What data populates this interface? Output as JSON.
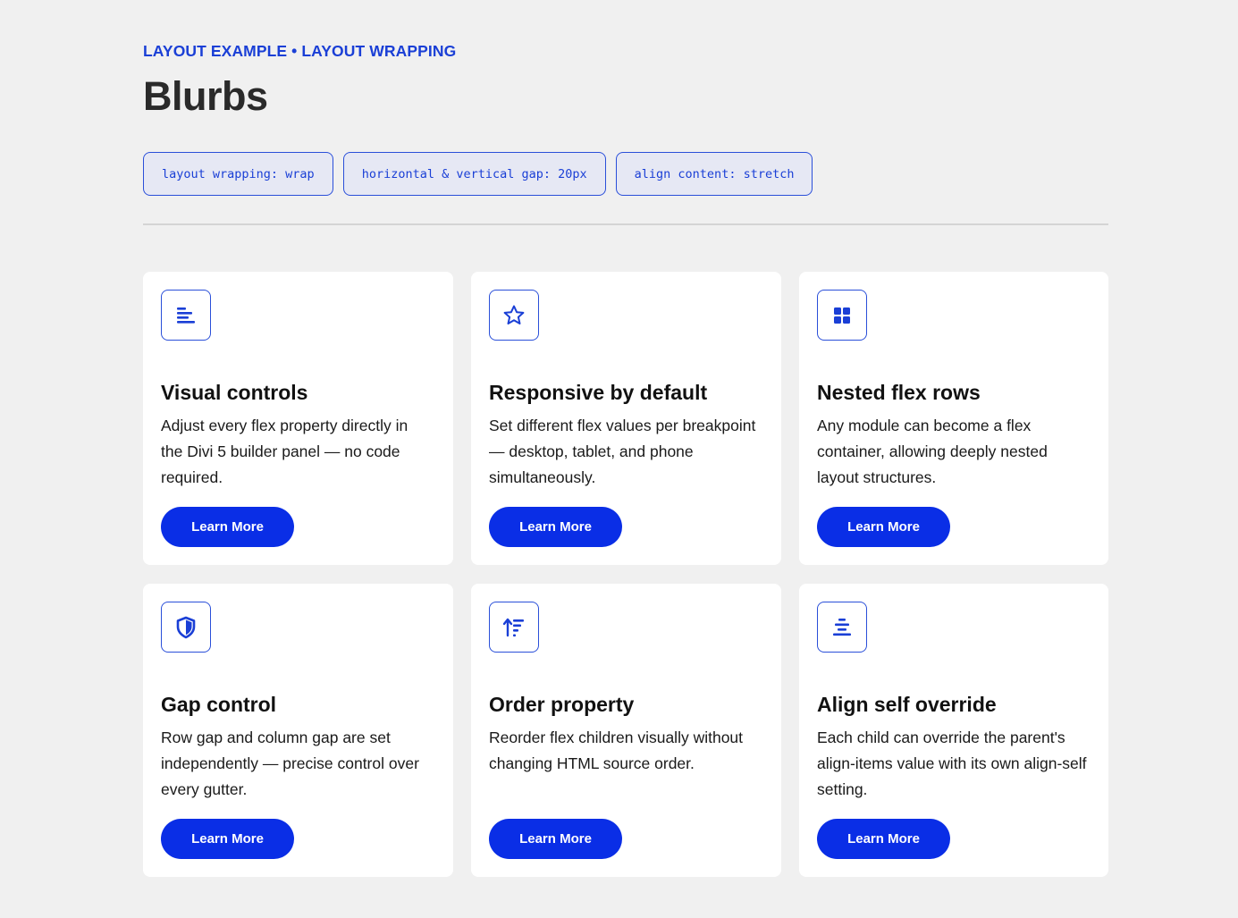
{
  "header": {
    "eyebrow": "LAYOUT EXAMPLE • LAYOUT WRAPPING",
    "title": "Blurbs"
  },
  "tags": [
    "layout wrapping: wrap",
    "horizontal & vertical gap: 20px",
    "align content: stretch"
  ],
  "colors": {
    "accent": "#0a2ee6",
    "accent_text": "#1a3fd6",
    "background": "#f0f0f0",
    "card": "#ffffff"
  },
  "cards": [
    {
      "icon": "align-left-icon",
      "title": "Visual controls",
      "text": "Adjust every flex property directly in the Divi 5 builder panel — no code required.",
      "button": "Learn More"
    },
    {
      "icon": "star-icon",
      "title": "Responsive by default",
      "text": "Set different flex values per breakpoint — desktop, tablet, and phone simultaneously.",
      "button": "Learn More"
    },
    {
      "icon": "grid-icon",
      "title": "Nested flex rows",
      "text": "Any module can become a flex container, allowing deeply nested layout structures.",
      "button": "Learn More"
    },
    {
      "icon": "shield-icon",
      "title": "Gap control",
      "text": "Row gap and column gap are set independently — precise control over every gutter.",
      "button": "Learn More"
    },
    {
      "icon": "sort-ascending-icon",
      "title": "Order property",
      "text": "Reorder flex children visually without changing HTML source order.",
      "button": "Learn More"
    },
    {
      "icon": "align-center-icon",
      "title": "Align self override",
      "text": "Each child can override the parent's align-items value with its own align-self setting.",
      "button": "Learn More"
    }
  ]
}
